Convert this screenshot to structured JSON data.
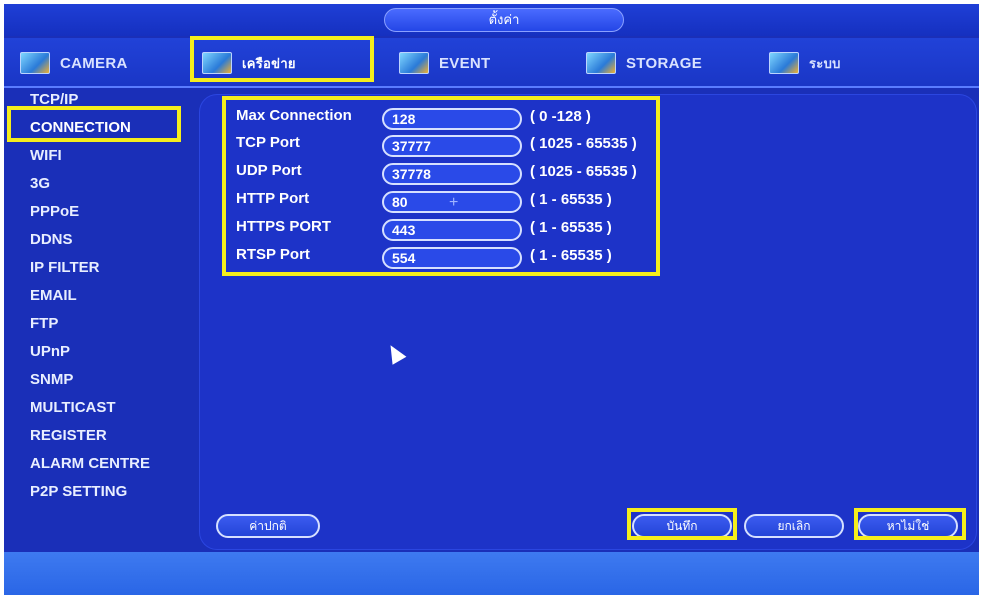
{
  "window": {
    "title": "ตั้งค่า"
  },
  "tabs": [
    {
      "label": "CAMERA",
      "icon": "camera-icon"
    },
    {
      "label": "เครือข่าย",
      "icon": "network-icon"
    },
    {
      "label": "EVENT",
      "icon": "event-icon"
    },
    {
      "label": "STORAGE",
      "icon": "storage-icon"
    },
    {
      "label": "ระบบ",
      "icon": "system-icon"
    }
  ],
  "sidebar": {
    "items": [
      "TCP/IP",
      "CONNECTION",
      "WIFI",
      "3G",
      "PPPoE",
      "DDNS",
      "IP FILTER",
      "EMAIL",
      "FTP",
      "UPnP",
      "SNMP",
      "MULTICAST",
      "REGISTER",
      "ALARM CENTRE",
      "P2P SETTING"
    ],
    "selected": "CONNECTION"
  },
  "connection": {
    "rows": [
      {
        "label": "Max Connection",
        "value": "128",
        "range": "( 0 -128 )"
      },
      {
        "label": "TCP Port",
        "value": "37777",
        "range": "( 1025 - 65535 )"
      },
      {
        "label": "UDP Port",
        "value": "37778",
        "range": "( 1025 - 65535 )"
      },
      {
        "label": "HTTP Port",
        "value": "80",
        "range": "( 1 - 65535 )"
      },
      {
        "label": "HTTPS PORT",
        "value": "443",
        "range": "( 1 - 65535 )"
      },
      {
        "label": "RTSP Port",
        "value": "554",
        "range": "( 1 - 65535 )"
      }
    ]
  },
  "buttons": {
    "default": "ค่าปกติ",
    "save": "บันทึก",
    "cancel": "ยกเลิก",
    "apply": "หาไม่ใช่"
  },
  "colors": {
    "background": "#1a2fb8",
    "highlight": "#f5ee1c",
    "timestamp": "#ff8a30"
  }
}
